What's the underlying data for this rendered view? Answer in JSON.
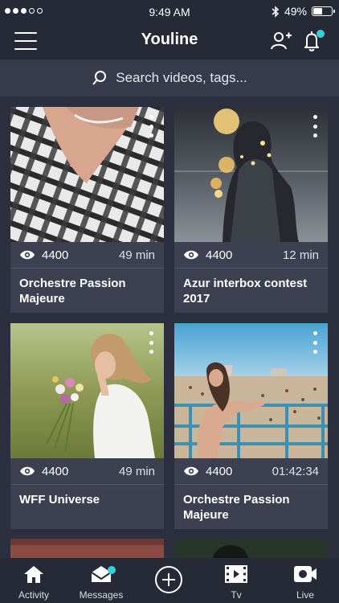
{
  "status_bar": {
    "time": "9:49 AM",
    "battery_percent": "49%",
    "battery_level": 0.49,
    "signal_bars_filled": 3,
    "signal_bars_total": 5
  },
  "header": {
    "title": "Youline",
    "notification_dot_color": "#35d0d5"
  },
  "search": {
    "placeholder": "Search videos, tags..."
  },
  "videos": [
    {
      "views": "4400",
      "duration": "49 min",
      "title": "Orchestre Passion Majeure"
    },
    {
      "views": "4400",
      "duration": "12 min",
      "title": "Azur interbox contest 2017"
    },
    {
      "views": "4400",
      "duration": "49 min",
      "title": "WFF Universe"
    },
    {
      "views": "4400",
      "duration": "01:42:34",
      "title": "Orchestre Passion Majeure"
    }
  ],
  "tabbar": {
    "items": [
      {
        "label": "Activity",
        "icon": "home-icon"
      },
      {
        "label": "Messages",
        "icon": "envelope-icon"
      },
      {
        "label": "",
        "icon": "add-circle-icon"
      },
      {
        "label": "Tv",
        "icon": "film-icon"
      },
      {
        "label": "Live",
        "icon": "video-camera-icon"
      }
    ]
  },
  "colors": {
    "background": "#2c2f3e",
    "bar": "#262a37",
    "card": "#3c4051",
    "accent": "#35d0d5"
  }
}
